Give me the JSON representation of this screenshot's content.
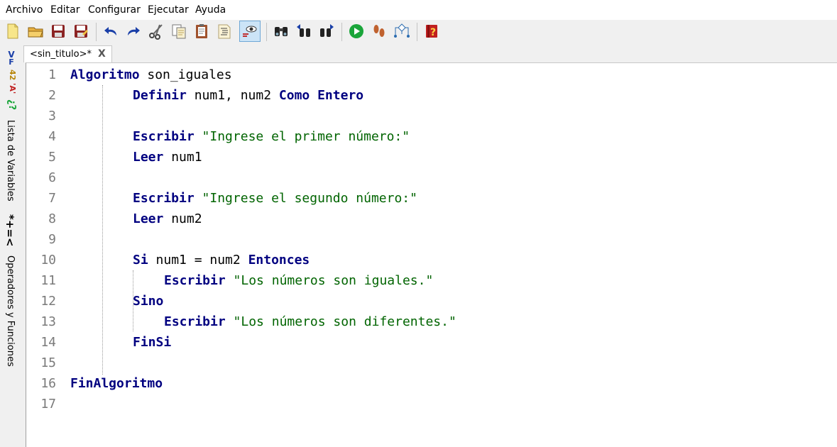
{
  "menu": [
    "Archivo",
    "Editar",
    "Configurar",
    "Ejecutar",
    "Ayuda"
  ],
  "toolbar": {
    "buttons": [
      {
        "name": "new-file-icon",
        "color": "#f5e27a"
      },
      {
        "name": "open-file-icon",
        "color": "#e8b040"
      },
      {
        "name": "save-icon",
        "color": "#8b2323"
      },
      {
        "name": "save-as-icon",
        "color": "#8b2323"
      },
      {
        "name": "undo-icon",
        "color": "#1a3fa8"
      },
      {
        "name": "redo-icon",
        "color": "#1a3fa8"
      },
      {
        "name": "cut-icon",
        "color": "#444444"
      },
      {
        "name": "copy-icon",
        "color": "#bca35a"
      },
      {
        "name": "paste-icon",
        "color": "#a0522d"
      },
      {
        "name": "indent-icon",
        "color": "#d4b15a"
      },
      {
        "name": "inspect-icon",
        "color": "#333333"
      },
      {
        "name": "search-icon",
        "color": "#222222"
      },
      {
        "name": "find-previous-icon",
        "color": "#222222"
      },
      {
        "name": "find-next-icon",
        "color": "#222222"
      },
      {
        "name": "run-icon",
        "color": "#1aa53a"
      },
      {
        "name": "step-icon",
        "color": "#c0622f"
      },
      {
        "name": "flowchart-icon",
        "color": "#2b6cb0"
      },
      {
        "name": "help-icon",
        "color": "#c02020"
      }
    ]
  },
  "sidebar": {
    "icons": [
      "V",
      "F",
      "42",
      "'A'",
      "¿?"
    ],
    "variables_label": "Lista de Variables",
    "operators_symbols": "*+=<",
    "operators_label": "Operadores y Funciones"
  },
  "tab": {
    "label": "<sin_titulo>*",
    "close": "X"
  },
  "editor": {
    "lines": [
      {
        "num": "1",
        "tokens": [
          {
            "t": "Algoritmo",
            "c": "kw"
          },
          {
            "t": " son_iguales",
            "c": "id"
          }
        ]
      },
      {
        "num": "2",
        "tokens": [
          {
            "t": "Definir",
            "c": "kw"
          },
          {
            "t": " num1, num2 ",
            "c": "id"
          },
          {
            "t": "Como Entero",
            "c": "kw"
          }
        ]
      },
      {
        "num": "3",
        "tokens": []
      },
      {
        "num": "4",
        "tokens": [
          {
            "t": "Escribir",
            "c": "kw"
          },
          {
            "t": " ",
            "c": "id"
          },
          {
            "t": "\"Ingrese el primer número:\"",
            "c": "str"
          }
        ]
      },
      {
        "num": "5",
        "tokens": [
          {
            "t": "Leer",
            "c": "kw"
          },
          {
            "t": " num1",
            "c": "id"
          }
        ]
      },
      {
        "num": "6",
        "tokens": []
      },
      {
        "num": "7",
        "tokens": [
          {
            "t": "Escribir",
            "c": "kw"
          },
          {
            "t": " ",
            "c": "id"
          },
          {
            "t": "\"Ingrese el segundo número:\"",
            "c": "str"
          }
        ]
      },
      {
        "num": "8",
        "tokens": [
          {
            "t": "Leer",
            "c": "kw"
          },
          {
            "t": " num2",
            "c": "id"
          }
        ]
      },
      {
        "num": "9",
        "tokens": []
      },
      {
        "num": "10",
        "tokens": [
          {
            "t": "Si",
            "c": "kw"
          },
          {
            "t": " num1 = num2 ",
            "c": "id"
          },
          {
            "t": "Entonces",
            "c": "kw"
          }
        ]
      },
      {
        "num": "11",
        "tokens": [
          {
            "t": "Escribir",
            "c": "kw"
          },
          {
            "t": " ",
            "c": "id"
          },
          {
            "t": "\"Los números son iguales.\"",
            "c": "str"
          }
        ]
      },
      {
        "num": "12",
        "tokens": [
          {
            "t": "Sino",
            "c": "kw"
          }
        ]
      },
      {
        "num": "13",
        "tokens": [
          {
            "t": "Escribir",
            "c": "kw"
          },
          {
            "t": " ",
            "c": "id"
          },
          {
            "t": "\"Los números son diferentes.\"",
            "c": "str"
          }
        ]
      },
      {
        "num": "14",
        "tokens": [
          {
            "t": "FinSi",
            "c": "kw"
          }
        ]
      },
      {
        "num": "15",
        "tokens": []
      },
      {
        "num": "16",
        "tokens": [
          {
            "t": "FinAlgoritmo",
            "c": "kw"
          }
        ]
      },
      {
        "num": "17",
        "tokens": []
      }
    ]
  }
}
